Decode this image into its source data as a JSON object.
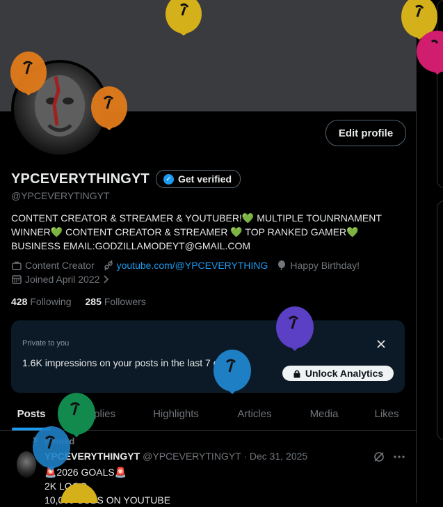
{
  "profile": {
    "name": "YPCEVERYTHINGYT",
    "verify_label": "Get verified",
    "handle": "@YPCEVERYTINGYT",
    "bio_line1": "CONTENT CREATOR & STREAMER & YOUTUBER!💚 MULTIPLE TOUNRNAMENT",
    "bio_line2": "WINNER💚 CONTENT CREATOR & STREAMER 💚 TOP RANKED GAMER💚",
    "bio_line3": "BUSINESS EMAIL:GODZILLAMODEYT@GMAIL.COM",
    "category": "Content Creator",
    "website": "youtube.com/@YPCEVERYTHING",
    "birthday": "Happy Birthday!",
    "joined": "Joined April 2022",
    "following_count": "428",
    "following_label": "Following",
    "followers_count": "285",
    "followers_label": "Followers",
    "edit_label": "Edit profile"
  },
  "analytics": {
    "private_label": "Private to you",
    "impressions_text": "1.6K impressions on your posts in the last 7 days",
    "unlock_label": "Unlock Analytics"
  },
  "tabs": [
    {
      "label": "Posts",
      "active": true
    },
    {
      "label": "Replies"
    },
    {
      "label": "Highlights"
    },
    {
      "label": "Articles"
    },
    {
      "label": "Media"
    },
    {
      "label": "Likes"
    }
  ],
  "post": {
    "pinned_label": "Pinned",
    "author": "YPCEVERYTHINGYT",
    "meta": "@YPCEVERYTINGYT · Dec 31, 2025",
    "line1": "🚨2026 GOALS🚨",
    "line2": "2K LOGO",
    "line3": "10,000 SUBS ON YOUTUBE"
  },
  "colors": {
    "accent": "#1d9bf0",
    "verified_badge": "#1d9bf0",
    "banner": "#3a3b3e"
  }
}
